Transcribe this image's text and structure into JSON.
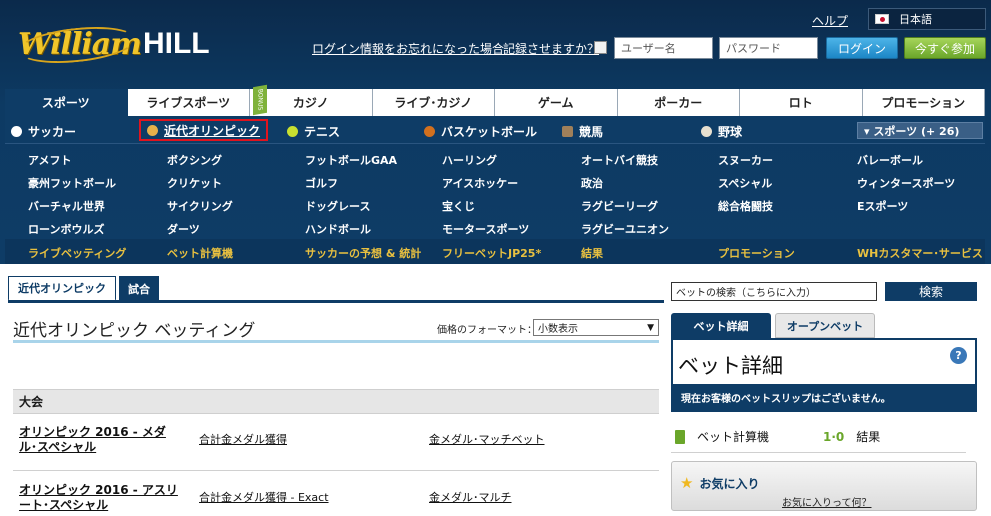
{
  "header": {
    "logo_script": "William",
    "logo_block": "HILL",
    "help": "ヘルプ",
    "language": "日本語",
    "forgot": "ログイン情報をお忘れになった場合",
    "remember": "記録させますか？",
    "username_placeholder": "ユーザー名",
    "password_placeholder": "パスワード",
    "login": "ログイン",
    "join": "今すぐ参加"
  },
  "main_nav": [
    "スポーツ",
    "ライブスポーツ",
    "カジノ",
    "ライブ･カジノ",
    "ゲーム",
    "ポーカー",
    "ロト",
    "プロモーション"
  ],
  "new_badge": "BONUS",
  "sub_nav": {
    "soccer": "サッカー",
    "olympic": "近代オリンピック",
    "tennis": "テニス",
    "basketball": "バスケットボール",
    "horse": "競馬",
    "baseball": "野球",
    "more": "▾ スポーツ (+ 26)"
  },
  "sports_grid": [
    [
      "アメフト",
      "ボクシング",
      "フットボールGAA",
      "ハーリング",
      "オートバイ競技",
      "スヌーカー",
      "バレーボール"
    ],
    [
      "豪州フットボール",
      "クリケット",
      "ゴルフ",
      "アイスホッケー",
      "政治",
      "スペシャル",
      "ウィンタースポーツ"
    ],
    [
      "バーチャル世界",
      "サイクリング",
      "ドッグレース",
      "宝くじ",
      "ラグビーリーグ",
      "総合格闘技",
      "Eスポーツ"
    ],
    [
      "ローンボウルズ",
      "ダーツ",
      "ハンドボール",
      "モータースポーツ",
      "ラグビーユニオン",
      "",
      ""
    ]
  ],
  "quick_links": [
    "ライブベッティング",
    "ベット計算機",
    "サッカーの予想 & 統計",
    "フリーベットJP25*",
    "結果",
    "プロモーション",
    "WHカスタマー･サービス"
  ],
  "content": {
    "tabs": [
      "近代オリンピック",
      "試合"
    ],
    "title": "近代オリンピック ベッティング",
    "price_format_label": "価格のフォーマット：",
    "price_format_value": "小数表示",
    "tournament_header": "大会",
    "events": [
      {
        "name": "オリンピック 2016 - メダル･スペシャル",
        "market1": "合計金メダル獲得",
        "market2": "金メダル･マッチベット"
      },
      {
        "name": "オリンピック 2016 - アスリート･スペシャル",
        "market1": "合計金メダル獲得 - Exact",
        "market2": "金メダル･マルチ"
      }
    ]
  },
  "sidebar": {
    "search_placeholder": "ベットの検索（こちらに入力）",
    "search_button": "検索",
    "slip_tabs": [
      "ベット詳細",
      "オープンベット"
    ],
    "slip_title": "ベット詳細",
    "slip_help": "?",
    "slip_empty": "現在お客様のベットスリップはございません。",
    "calculator": "ベット計算機",
    "results_icon": "1·0",
    "results": "結果",
    "favorites_title": "お気に入り",
    "favorites_link": "お気に入りって何？"
  },
  "colors": {
    "header_bg": "#0e3c66",
    "accent_yellow": "#e8c040",
    "login_blue": "#1c86c6",
    "join_green": "#6aa62a",
    "highlight_red": "#e0141e"
  }
}
